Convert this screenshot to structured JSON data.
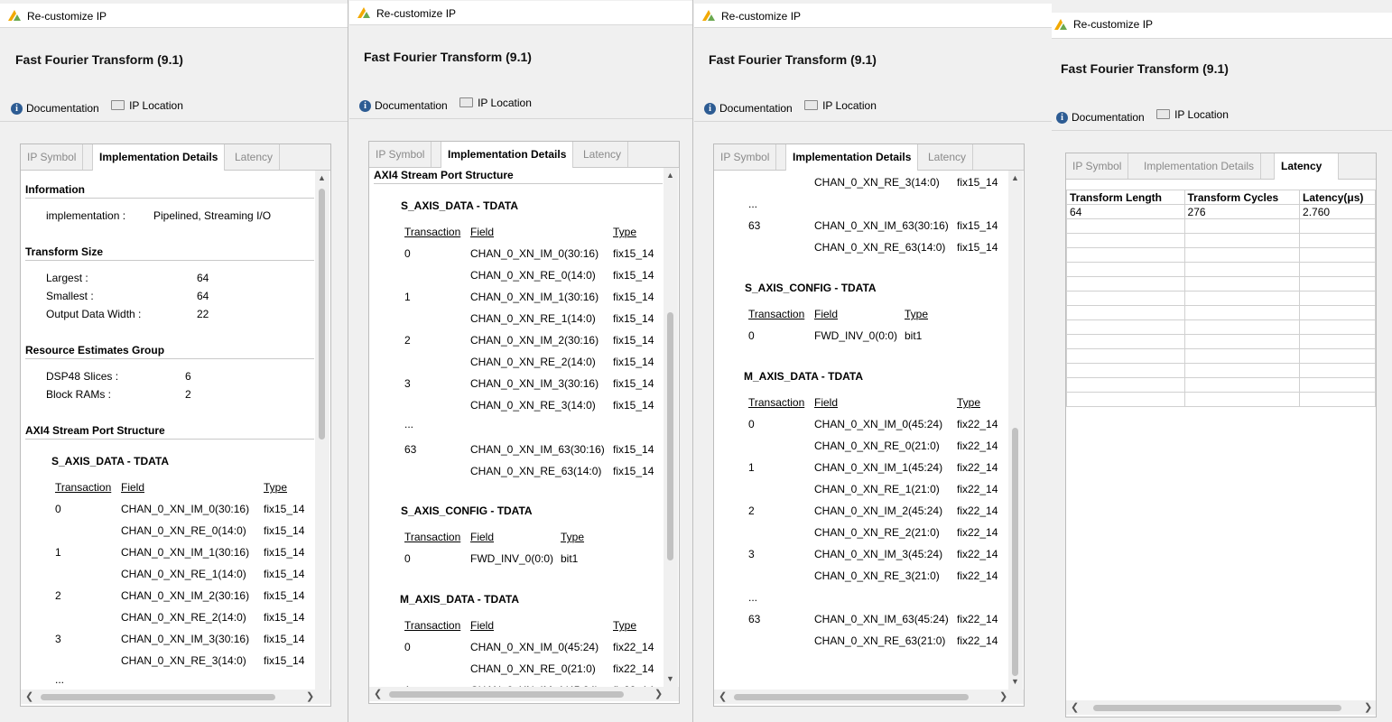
{
  "window_title": "Re-customize IP",
  "ip_name": "Fast Fourier Transform (9.1)",
  "links": {
    "documentation": "Documentation",
    "ip_location": "IP Location"
  },
  "tabs": {
    "symbol": "IP Symbol",
    "impl": "Implementation Details",
    "latency": "Latency"
  },
  "info": {
    "title": "Information",
    "impl_label": "implementation :",
    "impl_value": "Pipelined, Streaming I/O"
  },
  "transform_size": {
    "title": "Transform Size",
    "largest_label": "Largest :",
    "largest": "64",
    "smallest_label": "Smallest :",
    "smallest": "64",
    "odw_label": "Output Data Width :",
    "odw": "22"
  },
  "resources": {
    "title": "Resource Estimates Group",
    "dsp_label": "DSP48 Slices :",
    "dsp": "6",
    "bram_label": "Block RAMs :",
    "bram": "2"
  },
  "axi": {
    "title": "AXI4 Stream Port Structure"
  },
  "col": {
    "transaction": "Transaction",
    "field": "Field",
    "type": "Type"
  },
  "ellipsis": "...",
  "s_axis_data": {
    "title": "S_AXIS_DATA - TDATA",
    "rows": [
      {
        "t": "0",
        "f": "CHAN_0_XN_IM_0(30:16)",
        "ty": "fix15_14"
      },
      {
        "t": "",
        "f": "CHAN_0_XN_RE_0(14:0)",
        "ty": "fix15_14"
      },
      {
        "t": "1",
        "f": "CHAN_0_XN_IM_1(30:16)",
        "ty": "fix15_14"
      },
      {
        "t": "",
        "f": "CHAN_0_XN_RE_1(14:0)",
        "ty": "fix15_14"
      },
      {
        "t": "2",
        "f": "CHAN_0_XN_IM_2(30:16)",
        "ty": "fix15_14"
      },
      {
        "t": "",
        "f": "CHAN_0_XN_RE_2(14:0)",
        "ty": "fix15_14"
      },
      {
        "t": "3",
        "f": "CHAN_0_XN_IM_3(30:16)",
        "ty": "fix15_14"
      },
      {
        "t": "",
        "f": "CHAN_0_XN_RE_3(14:0)",
        "ty": "fix15_14"
      }
    ],
    "last": [
      {
        "t": "63",
        "f": "CHAN_0_XN_IM_63(30:16)",
        "ty": "fix15_14"
      },
      {
        "t": "",
        "f": "CHAN_0_XN_RE_63(14:0)",
        "ty": "fix15_14"
      }
    ]
  },
  "s_axis_config": {
    "title": "S_AXIS_CONFIG - TDATA",
    "rows": [
      {
        "t": "0",
        "f": "FWD_INV_0(0:0)",
        "ty": "bit1"
      }
    ]
  },
  "m_axis_data": {
    "title": "M_AXIS_DATA - TDATA",
    "rows": [
      {
        "t": "0",
        "f": "CHAN_0_XN_IM_0(45:24)",
        "ty": "fix22_14"
      },
      {
        "t": "",
        "f": "CHAN_0_XN_RE_0(21:0)",
        "ty": "fix22_14"
      },
      {
        "t": "1",
        "f": "CHAN_0_XN_IM_1(45:24)",
        "ty": "fix22_14"
      },
      {
        "t": "",
        "f": "CHAN_0_XN_RE_1(21:0)",
        "ty": "fix22_14"
      },
      {
        "t": "2",
        "f": "CHAN_0_XN_IM_2(45:24)",
        "ty": "fix22_14"
      },
      {
        "t": "",
        "f": "CHAN_0_XN_RE_2(21:0)",
        "ty": "fix22_14"
      },
      {
        "t": "3",
        "f": "CHAN_0_XN_IM_3(45:24)",
        "ty": "fix22_14"
      },
      {
        "t": "",
        "f": "CHAN_0_XN_RE_3(21:0)",
        "ty": "fix22_14"
      }
    ],
    "last": [
      {
        "t": "63",
        "f": "CHAN_0_XN_IM_63(45:24)",
        "ty": "fix22_14"
      },
      {
        "t": "",
        "f": "CHAN_0_XN_RE_63(21:0)",
        "ty": "fix22_14"
      }
    ]
  },
  "latency_table": {
    "headers": [
      "Transform Length",
      "Transform Cycles",
      "Latency(μs)"
    ],
    "rows": [
      [
        "64",
        "276",
        "2.760"
      ]
    ],
    "empty_rows": 13
  },
  "colors": {
    "accent_icon": "#2d5c93",
    "logo_yellow": "#f2a900",
    "logo_green": "#6aa84f"
  },
  "icons": [
    "vivado-logo-icon",
    "info-icon",
    "folder-icon",
    "scroll-up-arrow-icon",
    "scroll-down-arrow-icon",
    "scroll-left-arrow-icon",
    "scroll-right-arrow-icon"
  ]
}
